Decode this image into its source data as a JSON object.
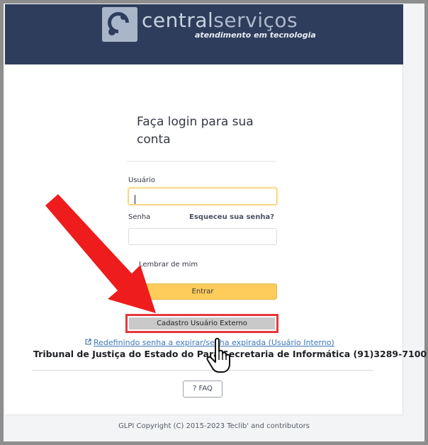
{
  "header": {
    "logo_primary": "central",
    "logo_secondary": "serviços",
    "tagline": "atendimento em tecnologia"
  },
  "login": {
    "title": "Faça login para sua conta",
    "username_label": "Usuário",
    "username_value": "",
    "password_label": "Senha",
    "forgot_link": "Esqueceu sua senha?",
    "password_value": "",
    "remember_label": "Lembrar de mim",
    "submit_label": "Entrar",
    "external_signup_label": "Cadastro Usuário Externo",
    "reset_link": "Redefinindo senha a expirar/senha expirada (Usuário Interno)"
  },
  "footer": {
    "org_line": "Tribunal de Justiça do Estado do Pará Secretaria de Informática (91)3289-7100",
    "faq_label": "? FAQ",
    "copyright": "GLPI Copyright (C) 2015-2023 Teclib' and contributors"
  },
  "icons": {
    "logo": "logo-mark-icon",
    "external_link": "external-link-icon",
    "annotation_arrow": "red-arrow-icon",
    "pointer": "hand-pointer-icon"
  },
  "colors": {
    "header_bg": "#2f3d5c",
    "primary_button": "#fdcc5a",
    "highlight": "#e5383b",
    "link": "#3c79b8"
  }
}
